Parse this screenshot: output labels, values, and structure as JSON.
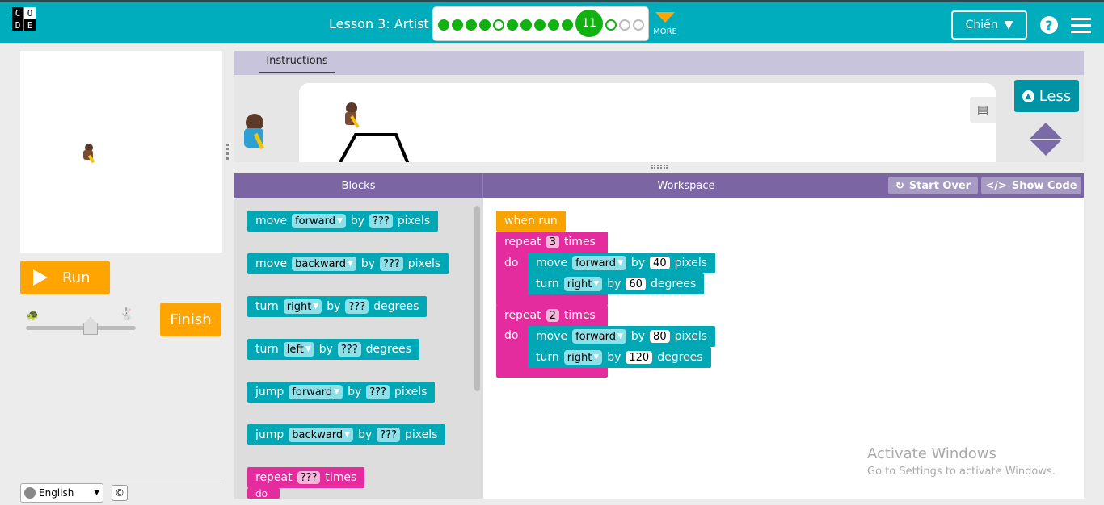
{
  "header": {
    "logo_letters": [
      "C",
      "O",
      "D",
      "E"
    ],
    "lesson_title": "Lesson 3: Artist",
    "current_level": "11",
    "more_label": "MORE",
    "user_name": "Chiến"
  },
  "stage": {
    "run_label": "Run",
    "finish_label": "Finish",
    "language": "English",
    "copyright": "©"
  },
  "instructions": {
    "tab_label": "Instructions",
    "less_label": "Less"
  },
  "editor": {
    "blocks_header": "Blocks",
    "workspace_header": "Workspace",
    "start_over_label": "Start Over",
    "show_code_label": "Show Code"
  },
  "toolbox": [
    {
      "verb": "move",
      "dir": "forward",
      "by": "by",
      "val": "???",
      "unit": "pixels"
    },
    {
      "verb": "move",
      "dir": "backward",
      "by": "by",
      "val": "???",
      "unit": "pixels"
    },
    {
      "verb": "turn",
      "dir": "right",
      "by": "by",
      "val": "???",
      "unit": "degrees"
    },
    {
      "verb": "turn",
      "dir": "left",
      "by": "by",
      "val": "???",
      "unit": "degrees"
    },
    {
      "verb": "jump",
      "dir": "forward",
      "by": "by",
      "val": "???",
      "unit": "pixels"
    },
    {
      "verb": "jump",
      "dir": "backward",
      "by": "by",
      "val": "???",
      "unit": "pixels"
    },
    {
      "verb": "repeat",
      "val": "???",
      "unit": "times",
      "do": "do"
    }
  ],
  "program": {
    "when_run": "when run",
    "loops": [
      {
        "repeat": "repeat",
        "count": "3",
        "times": "times",
        "do": "do",
        "move": {
          "verb": "move",
          "dir": "forward",
          "by": "by",
          "val": "40",
          "unit": "pixels"
        },
        "turn": {
          "verb": "turn",
          "dir": "right",
          "by": "by",
          "val": "60",
          "unit": "degrees"
        }
      },
      {
        "repeat": "repeat",
        "count": "2",
        "times": "times",
        "do": "do",
        "move": {
          "verb": "move",
          "dir": "forward",
          "by": "by",
          "val": "80",
          "unit": "pixels"
        },
        "turn": {
          "verb": "turn",
          "dir": "right",
          "by": "by",
          "val": "120",
          "unit": "degrees"
        }
      }
    ]
  },
  "watermark": {
    "title": "Activate Windows",
    "subtitle": "Go to Settings to activate Windows."
  },
  "colors": {
    "topbar": "#00adbc",
    "run": "#ffa400",
    "teal_block": "#00a7b5",
    "pink_block": "#e52c9e",
    "event_block": "#f8a300"
  }
}
